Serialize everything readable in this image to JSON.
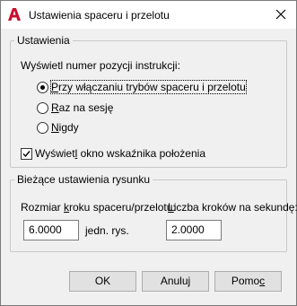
{
  "window": {
    "title": "Ustawienia spaceru i przelotu"
  },
  "colors": {
    "icon_red": "#c8102e",
    "window_bg": "#f0f0f0",
    "titlebar_bg": "#ffffff"
  },
  "icons": {
    "app": "autocad-a-icon",
    "close": "close-icon"
  },
  "settings_group": {
    "legend": "Ustawienia",
    "display_label": "Wyświetl numer pozycji instrukcji:",
    "options": [
      {
        "label": "Przy włączaniu trybów spaceru i przelotu",
        "checked": true
      },
      {
        "label": "Raz na sesję",
        "checked": false
      },
      {
        "label": "Nigdy",
        "checked": false
      }
    ],
    "checkbox_label": "Wyświetl okno wskaźnika położenia",
    "checkbox_checked": true
  },
  "drawing_group": {
    "legend": "Bieżące ustawienia rysunku",
    "step_size_label": "Rozmiar kroku spaceru/przelotu:",
    "step_size_value": "6.0000",
    "step_size_unit": "jedn. rys.",
    "steps_per_sec_label": "Liczba kroków na sekundę:",
    "steps_per_sec_value": "2.0000"
  },
  "buttons": {
    "ok": "OK",
    "cancel": "Anuluj",
    "help": "Pomoc"
  }
}
